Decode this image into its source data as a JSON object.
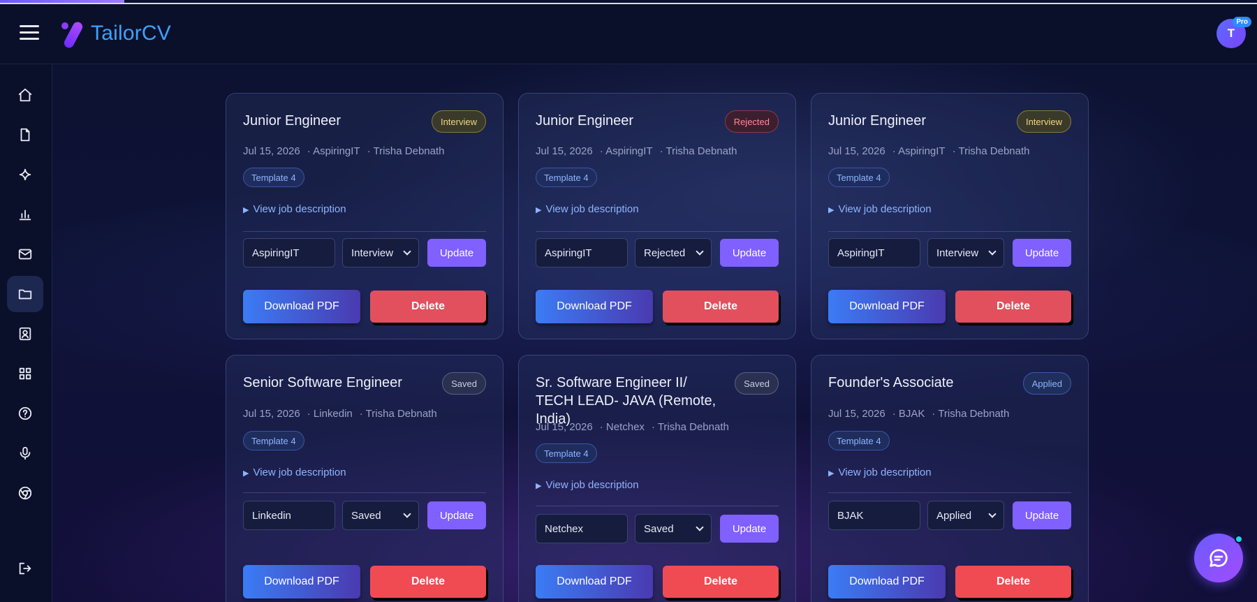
{
  "app": {
    "name": "TailorCV",
    "avatar_initial": "T",
    "plan_badge": "Pro"
  },
  "colors": {
    "accent": "#8060ff",
    "brand": "#3ea2ff",
    "delete": "#e2505e"
  },
  "sidebar": {
    "items": [
      {
        "icon": "home-icon"
      },
      {
        "icon": "document-icon"
      },
      {
        "icon": "sparkle-icon"
      },
      {
        "icon": "bar-chart-icon"
      },
      {
        "icon": "mail-icon"
      },
      {
        "icon": "folder-icon",
        "active": true
      },
      {
        "icon": "contact-card-icon"
      },
      {
        "icon": "grid-icon"
      },
      {
        "icon": "help-icon"
      },
      {
        "icon": "microphone-icon"
      },
      {
        "icon": "chrome-icon"
      },
      {
        "icon": "logout-icon"
      }
    ]
  },
  "cards": [
    {
      "title": "Junior Engineer",
      "status": "Interview",
      "date": "Jul 15, 2026",
      "company": "· AspiringIT",
      "author": "· Trisha Debnath",
      "template": "Template 4",
      "view_jd": "View job description",
      "company_value": "AspiringIT",
      "select_value": "Interview",
      "update": "Update",
      "download": "Download PDF",
      "delete": "Delete"
    },
    {
      "title": "Junior Engineer",
      "status": "Rejected",
      "date": "Jul 15, 2026",
      "company": "· AspiringIT",
      "author": "· Trisha Debnath",
      "template": "Template 4",
      "view_jd": "View job description",
      "company_value": "AspiringIT",
      "select_value": "Rejected",
      "update": "Update",
      "download": "Download PDF",
      "delete": "Delete"
    },
    {
      "title": "Junior Engineer",
      "status": "Interview",
      "date": "Jul 15, 2026",
      "company": "· AspiringIT",
      "author": "· Trisha Debnath",
      "template": "Template 4",
      "view_jd": "View job description",
      "company_value": "AspiringIT",
      "select_value": "Interview",
      "update": "Update",
      "download": "Download PDF",
      "delete": "Delete"
    },
    {
      "title": "Senior Software Engineer",
      "status": "Saved",
      "date": "Jul 15, 2026",
      "company": "· Linkedin",
      "author": "· Trisha Debnath",
      "template": "Template 4",
      "view_jd": "View job description",
      "company_value": "Linkedin",
      "select_value": "Saved",
      "update": "Update",
      "download": "Download PDF",
      "delete": "Delete"
    },
    {
      "title": "Sr. Software Engineer II/ TECH LEAD- JAVA (Remote, India)",
      "status": "Saved",
      "date": "Jul 15, 2026",
      "company": "· Netchex",
      "author": "· Trisha Debnath",
      "template": "Template 4",
      "view_jd": "View job description",
      "company_value": "Netchex",
      "select_value": "Saved",
      "update": "Update",
      "download": "Download PDF",
      "delete": "Delete"
    },
    {
      "title": "Founder's Associate",
      "status": "Applied",
      "date": "Jul 15, 2026",
      "company": "· BJAK",
      "author": "· Trisha Debnath",
      "template": "Template 4",
      "view_jd": "View job description",
      "company_value": "BJAK",
      "select_value": "Applied",
      "update": "Update",
      "download": "Download PDF",
      "delete": "Delete"
    }
  ]
}
